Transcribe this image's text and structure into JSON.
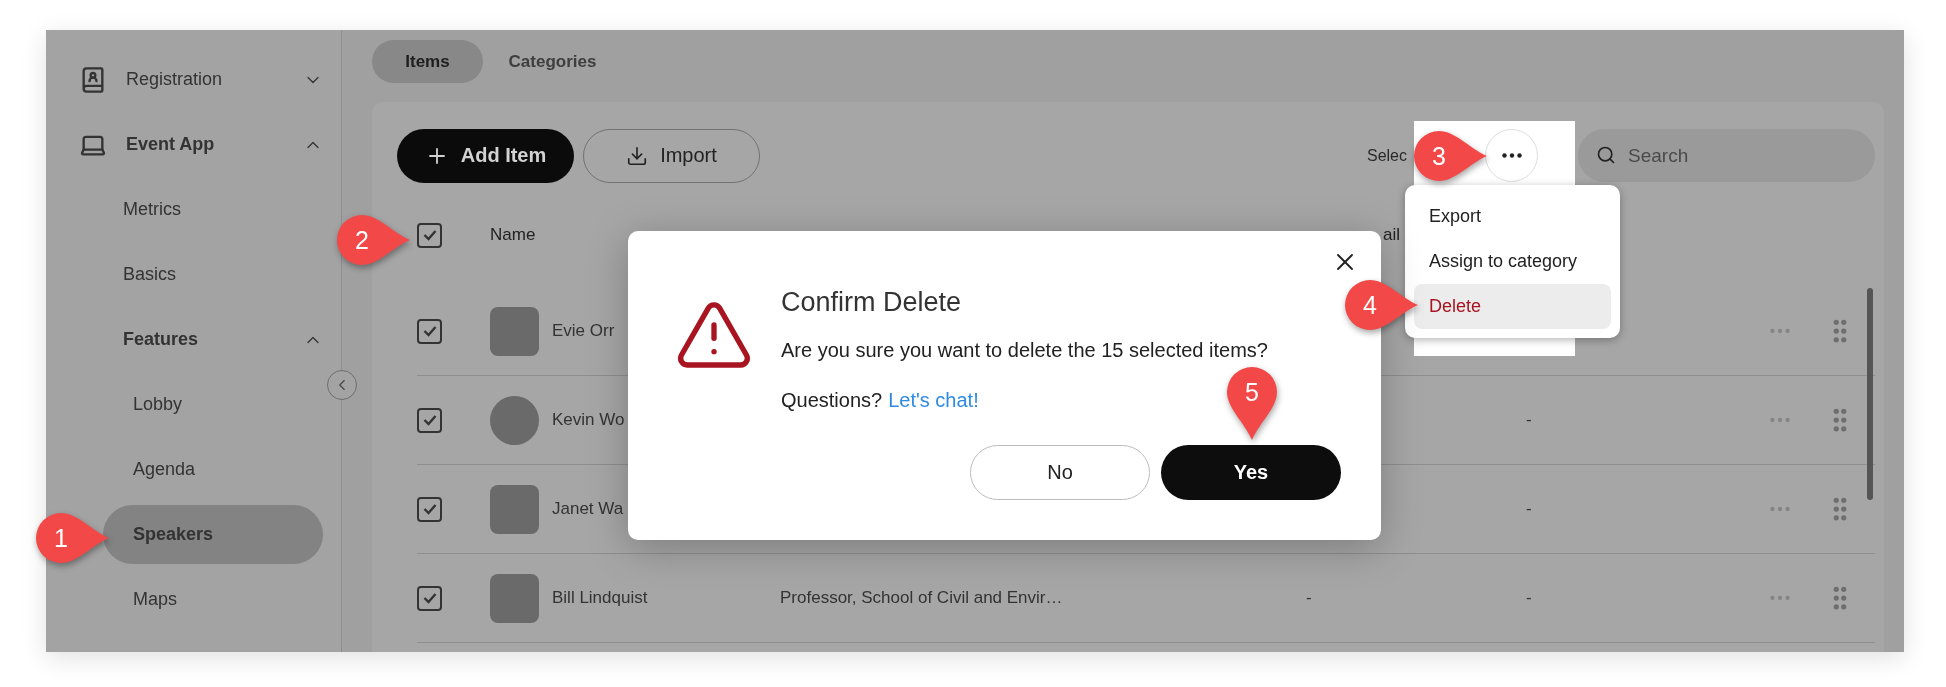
{
  "sidebar": {
    "items": [
      {
        "label": "Registration",
        "kind": "group",
        "expanded": false
      },
      {
        "label": "Event App",
        "kind": "group",
        "expanded": true,
        "children": [
          {
            "label": "Metrics",
            "selected": false
          },
          {
            "label": "Basics",
            "selected": false
          },
          {
            "label": "Features",
            "kind": "group",
            "expanded": true,
            "children": [
              {
                "label": "Lobby",
                "selected": false
              },
              {
                "label": "Agenda",
                "selected": false
              },
              {
                "label": "Speakers",
                "selected": true
              },
              {
                "label": "Maps",
                "selected": false
              }
            ]
          }
        ]
      }
    ]
  },
  "tabs": [
    {
      "label": "Items",
      "selected": true
    },
    {
      "label": "Categories",
      "selected": false
    }
  ],
  "toolbar": {
    "add_button": "Add Item",
    "import_button": "Import",
    "selection_label": "Selec",
    "search": {
      "placeholder": "Search"
    }
  },
  "more_menu": {
    "items": [
      {
        "label": "Export",
        "kind": "normal",
        "selected": false
      },
      {
        "label": "Assign to category",
        "kind": "normal",
        "selected": false
      },
      {
        "label": "Delete",
        "kind": "danger",
        "selected": true
      }
    ]
  },
  "table": {
    "select_all_checked": true,
    "columns": [
      {
        "label": "Name"
      },
      {
        "label": "ail"
      }
    ],
    "rows": [
      {
        "checked": true,
        "kind": "square",
        "name": "Evie Orr"
      },
      {
        "checked": true,
        "kind": "round",
        "name": "Kevin Wo",
        "column_6": "-"
      },
      {
        "checked": true,
        "kind": "square",
        "name": "Janet Wa",
        "column_6": "-"
      },
      {
        "checked": true,
        "kind": "square",
        "name": "Bill Lindquist",
        "title": "Professor, School of Civil and Envir…",
        "column_5": "-",
        "column_6": "-"
      }
    ]
  },
  "dialog": {
    "title": "Confirm Delete",
    "message": "Are you sure you want to delete the 15 selected items?",
    "help_text": "Questions?",
    "help_link": "Let's chat!",
    "buttons": [
      {
        "label": "No",
        "kind": "secondary"
      },
      {
        "label": "Yes",
        "kind": "primary"
      }
    ]
  },
  "callouts": [
    {
      "number": "1"
    },
    {
      "number": "2"
    },
    {
      "number": "3"
    },
    {
      "number": "4"
    },
    {
      "number": "5"
    }
  ]
}
